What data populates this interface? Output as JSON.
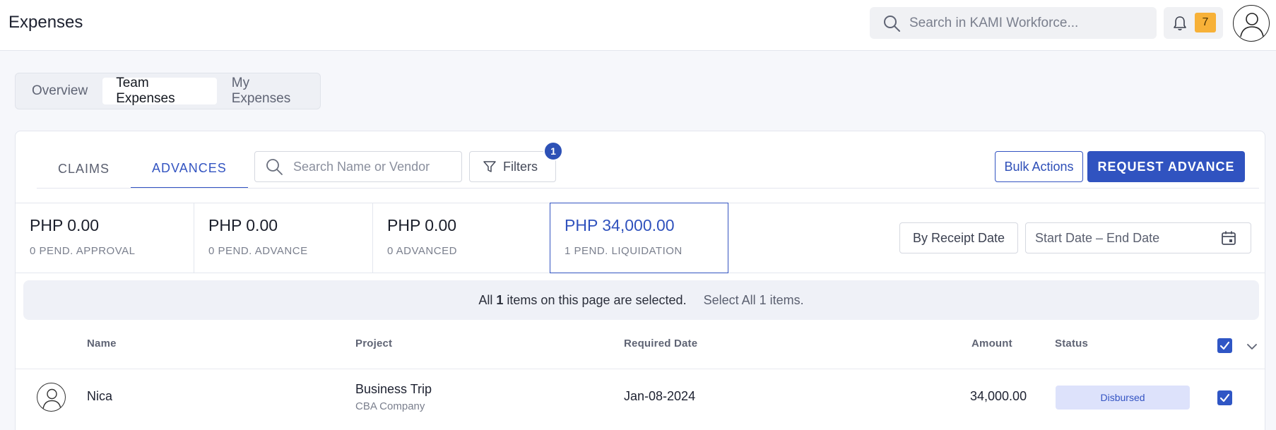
{
  "header": {
    "title": "Expenses",
    "search_placeholder": "Search in KAMI Workforce...",
    "notification_count": "7"
  },
  "segments": [
    {
      "label": "Overview"
    },
    {
      "label": "Team Expenses",
      "active": true
    },
    {
      "label": "My Expenses"
    }
  ],
  "tabs": [
    {
      "label": "CLAIMS"
    },
    {
      "label": "ADVANCES",
      "active": true
    }
  ],
  "toolbar": {
    "search_placeholder": "Search Name or Vendor",
    "filters_label": "Filters",
    "filters_count": "1",
    "bulk_actions_label": "Bulk Actions",
    "request_advance_label": "REQUEST ADVANCE"
  },
  "summary": [
    {
      "amount": "PHP 0.00",
      "label": "0  PEND. APPROVAL"
    },
    {
      "amount": "PHP 0.00",
      "label": "0  PEND. ADVANCE"
    },
    {
      "amount": "PHP 0.00",
      "label": "0 ADVANCED"
    },
    {
      "amount": "PHP 34,000.00",
      "label": "1  PEND. LIQUIDATION",
      "selected": true
    }
  ],
  "date_filter": {
    "by_label": "By Receipt Date",
    "range_placeholder": "Start Date – End Date"
  },
  "selection_banner": {
    "prefix": "All",
    "count": "1",
    "suffix": "items on this page are selected.",
    "select_all_label": "Select All 1 items."
  },
  "table": {
    "columns": [
      "Name",
      "Project",
      "Required Date",
      "Amount",
      "Status"
    ],
    "rows": [
      {
        "name": "Nica",
        "project": "Business Trip",
        "company": "CBA Company",
        "required_date": "Jan-08-2024",
        "amount": "34,000.00",
        "status": "Disbursed",
        "selected": true
      }
    ]
  },
  "colors": {
    "accent": "#3354c1",
    "badge_orange": "#f7b138",
    "status_bg": "#dde2fb"
  }
}
